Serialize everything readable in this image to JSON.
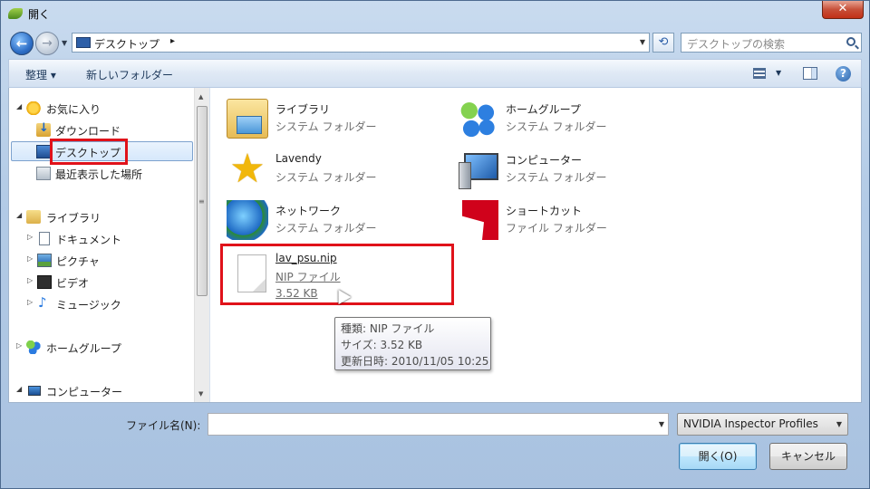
{
  "window": {
    "title": "開く",
    "close_glyph": "✕"
  },
  "address": {
    "location": "デスクトップ",
    "separator": "▸",
    "search_placeholder": "デスクトップの検索"
  },
  "toolbar": {
    "organize": "整理 ▾",
    "new_folder": "新しいフォルダー",
    "help": "?"
  },
  "nav": {
    "favorites": "お気に入り",
    "downloads": "ダウンロード",
    "desktop": "デスクトップ",
    "recent": "最近表示した場所",
    "libraries": "ライブラリ",
    "documents": "ドキュメント",
    "pictures": "ピクチャ",
    "videos": "ビデオ",
    "music": "ミュージック",
    "homegroup": "ホームグループ",
    "computer": "コンピューター"
  },
  "files": [
    {
      "name": "ライブラリ",
      "type": "システム フォルダー",
      "icon": "library-icon"
    },
    {
      "name": "ホームグループ",
      "type": "システム フォルダー",
      "icon": "homegroup-icon"
    },
    {
      "name": "Lavendy",
      "type": "システム フォルダー",
      "icon": "user-star-icon"
    },
    {
      "name": "コンピューター",
      "type": "システム フォルダー",
      "icon": "computer-icon"
    },
    {
      "name": "ネットワーク",
      "type": "システム フォルダー",
      "icon": "network-icon"
    },
    {
      "name": "ショートカット",
      "type": "ファイル フォルダー",
      "icon": "shortcut-icon"
    }
  ],
  "nip_file": {
    "name": "lav_psu.nip",
    "type": "NIP ファイル",
    "size": "3.52 KB"
  },
  "tooltip": {
    "type_line": "種類: NIP ファイル",
    "size_line": "サイズ: 3.52 KB",
    "date_line": "更新日時: 2010/11/05 10:25"
  },
  "bottom": {
    "filename_label": "ファイル名(N):",
    "filename_value": "",
    "filetype": "NVIDIA Inspector Profiles",
    "open_button": "開く(O)",
    "cancel_button": "キャンセル"
  },
  "colors": {
    "highlight_box": "#e0121a",
    "selection": "#d6e8fb"
  }
}
